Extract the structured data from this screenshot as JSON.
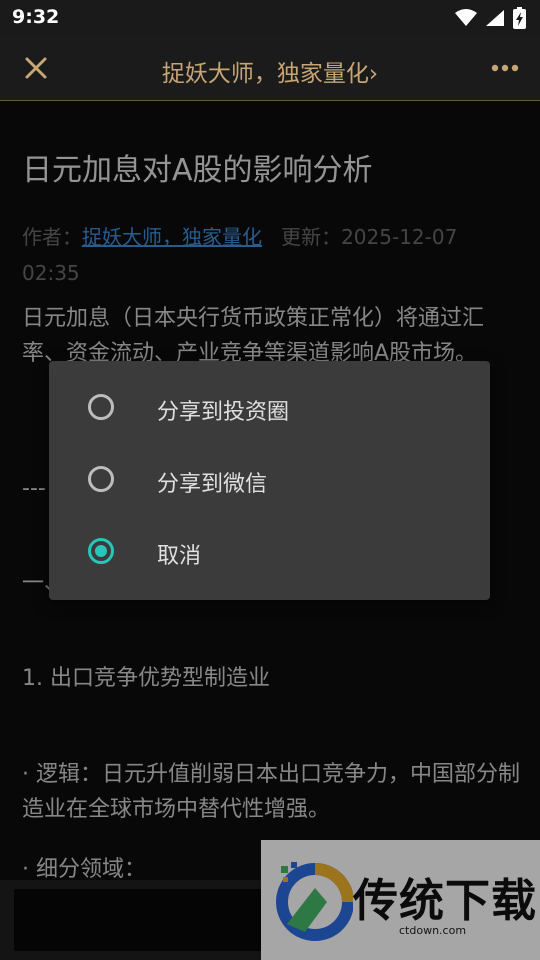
{
  "status_bar": {
    "time": "9:32",
    "icons": [
      "wifi-icon",
      "signal-icon",
      "battery-icon"
    ]
  },
  "app_bar": {
    "title": "捉妖大师，独家量化",
    "chevron": "›",
    "close_icon": "close-icon",
    "more_icon": "more-icon"
  },
  "article": {
    "title": "日元加息对A股的影响分析",
    "author_label": "作者：",
    "author_name": "捉妖大师，独家量化",
    "updated_label": "更新：",
    "updated_value": "2025-12-07 02:35",
    "paragraphs": [
      "日元加息（日本央行货币政策正常化）将通过汇率、资金流动、产业竞争等渠道影响A股市场。",
      "---",
      "一、",
      "1. 出口竞争优势型制造业",
      "· 逻辑：日元升值削弱日本出口竞争力，中国部分制造业在全球市场中替代性增强。",
      "· 细分领域："
    ]
  },
  "share_dialog": {
    "options": [
      {
        "label": "分享到投资圈",
        "selected": false
      },
      {
        "label": "分享到微信",
        "selected": false
      },
      {
        "label": "取消",
        "selected": true
      }
    ],
    "accent_color": "#26c6ba"
  },
  "watermark": {
    "text": "传统下载",
    "domain": "ctdown.com"
  },
  "colors": {
    "title_gold": "#c7a574",
    "link_blue": "#3d8ed9",
    "background": "#0d0d0d"
  }
}
